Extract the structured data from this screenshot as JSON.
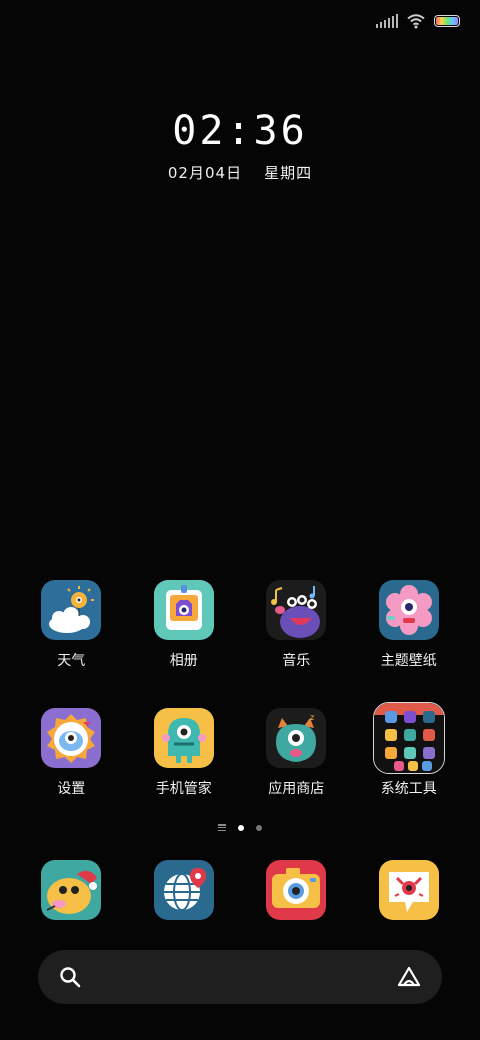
{
  "status_bar": {
    "icons": [
      "signal-icon",
      "wifi-icon",
      "battery-icon"
    ]
  },
  "lockscreen": {
    "time": "02:36",
    "date": "02月04日",
    "weekday": "星期四"
  },
  "home_apps": [
    {
      "label": "天气",
      "icon": "weather-icon"
    },
    {
      "label": "相册",
      "icon": "gallery-icon"
    },
    {
      "label": "音乐",
      "icon": "music-icon"
    },
    {
      "label": "主题壁纸",
      "icon": "themes-icon"
    },
    {
      "label": "设置",
      "icon": "settings-icon"
    },
    {
      "label": "手机管家",
      "icon": "security-icon"
    },
    {
      "label": "应用商店",
      "icon": "app-store-icon"
    },
    {
      "label": "系统工具",
      "icon": "tools-folder-icon"
    }
  ],
  "page_indicator": {
    "pages": 2,
    "current": 1
  },
  "dock_apps": [
    {
      "icon": "phone-icon"
    },
    {
      "icon": "browser-icon"
    },
    {
      "icon": "camera-icon"
    },
    {
      "icon": "messages-icon"
    }
  ],
  "search": {
    "icons": [
      "search-icon",
      "assistant-icon"
    ]
  },
  "colors": {
    "background": "#050505",
    "search_bar": "#1f1f1f",
    "text": "#f3f3f3"
  }
}
